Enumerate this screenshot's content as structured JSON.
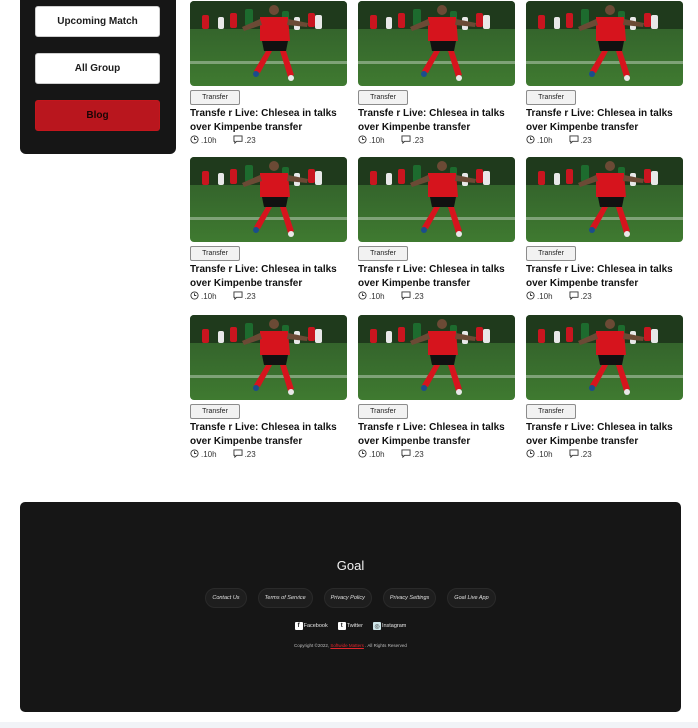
{
  "sidebar": {
    "buttons": [
      "Upcoming Match",
      "All Group",
      "Blog"
    ]
  },
  "cards": [
    {
      "tag": "Transfer",
      "title": "Transfe r Live: Chlesea in talks over Kimpenbe transfer",
      "time": ".10h",
      "comments": ".23"
    },
    {
      "tag": "Transfer",
      "title": "Transfe r Live: Chlesea in talks over Kimpenbe transfer",
      "time": ".10h",
      "comments": ".23"
    },
    {
      "tag": "Transfer",
      "title": "Transfe r Live: Chlesea in talks over Kimpenbe transfer",
      "time": ".10h",
      "comments": ".23"
    },
    {
      "tag": "Transfer",
      "title": "Transfe r Live: Chlesea in talks over Kimpenbe transfer",
      "time": ".10h",
      "comments": ".23"
    },
    {
      "tag": "Transfer",
      "title": "Transfe r Live: Chlesea in talks over Kimpenbe transfer",
      "time": ".10h",
      "comments": ".23"
    },
    {
      "tag": "Transfer",
      "title": "Transfe r Live: Chlesea in talks over Kimpenbe transfer",
      "time": ".10h",
      "comments": ".23"
    },
    {
      "tag": "Transfer",
      "title": "Transfe r Live: Chlesea in talks over Kimpenbe transfer",
      "time": ".10h",
      "comments": ".23"
    },
    {
      "tag": "Transfer",
      "title": "Transfe r Live: Chlesea in talks over Kimpenbe transfer",
      "time": ".10h",
      "comments": ".23"
    },
    {
      "tag": "Transfer",
      "title": "Transfe r Live: Chlesea in talks over Kimpenbe transfer",
      "time": ".10h",
      "comments": ".23"
    }
  ],
  "footer": {
    "brand": "Goal",
    "links": [
      "Contact Us",
      "Terms of Service",
      "Privacy Policy",
      "Privacy Settings",
      "Goal Live App"
    ],
    "social": [
      "Facebook",
      "Twitter",
      "Instagram"
    ],
    "copyright_prefix": "Copyright ©2022,",
    "copyright_company": "Softwide Matters",
    "copyright_suffix": ". All Rights Reserved"
  },
  "colors": {
    "accent": "#c4161c",
    "dark": "#161616"
  }
}
